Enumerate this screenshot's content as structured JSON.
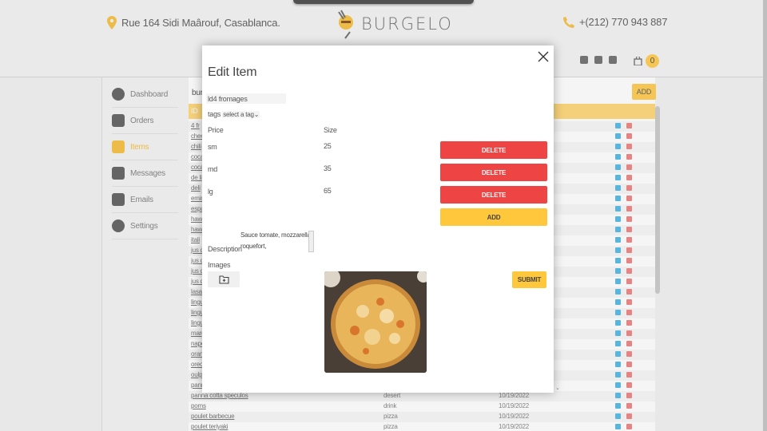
{
  "header": {
    "address": "Rue 164 Sidi Maârouf, Casablanca.",
    "brand": "BURGELO",
    "phone": "+(212) 770 943 887",
    "cart_count": "0"
  },
  "sidebar": {
    "items": [
      {
        "label": "Dashboard",
        "icon": "dashboard-icon"
      },
      {
        "label": "Orders",
        "icon": "orders-icon"
      },
      {
        "label": "Items",
        "icon": "items-icon"
      },
      {
        "label": "Messages",
        "icon": "messages-icon"
      },
      {
        "label": "Emails",
        "icon": "email-icon"
      },
      {
        "label": "Settings",
        "icon": "gear-icon"
      }
    ],
    "active": "Items"
  },
  "table": {
    "title": "bur",
    "add_label": "ADD",
    "header_first": "ID",
    "rows": [
      {
        "name": "4 fr",
        "category": "",
        "date": ""
      },
      {
        "name": "chee",
        "category": "",
        "date": ""
      },
      {
        "name": "chili",
        "category": "",
        "date": ""
      },
      {
        "name": "coca",
        "category": "",
        "date": ""
      },
      {
        "name": "coca",
        "category": "",
        "date": ""
      },
      {
        "name": "de li",
        "category": "",
        "date": ""
      },
      {
        "name": "deli",
        "category": "",
        "date": ""
      },
      {
        "name": "emin",
        "category": "",
        "date": ""
      },
      {
        "name": "espa",
        "category": "",
        "date": ""
      },
      {
        "name": "haw",
        "category": "",
        "date": ""
      },
      {
        "name": "haw",
        "category": "",
        "date": ""
      },
      {
        "name": "itali",
        "category": "",
        "date": ""
      },
      {
        "name": "jus d",
        "category": "",
        "date": ""
      },
      {
        "name": "jus d",
        "category": "",
        "date": ""
      },
      {
        "name": "jus d",
        "category": "",
        "date": ""
      },
      {
        "name": "jus d",
        "category": "",
        "date": ""
      },
      {
        "name": "lasa",
        "category": "",
        "date": ""
      },
      {
        "name": "lingu",
        "category": "",
        "date": ""
      },
      {
        "name": "lingu",
        "category": "",
        "date": ""
      },
      {
        "name": "lingu",
        "category": "",
        "date": ""
      },
      {
        "name": "marg",
        "category": "",
        "date": ""
      },
      {
        "name": "napo",
        "category": "",
        "date": ""
      },
      {
        "name": "oran",
        "category": "",
        "date": ""
      },
      {
        "name": "oreo",
        "category": "",
        "date": ""
      },
      {
        "name": "oulp",
        "category": "",
        "date": ""
      },
      {
        "name": "pann",
        "category": "",
        "date": ""
      },
      {
        "name": "panna cotta speculos",
        "category": "desert",
        "date": "10/19/2022"
      },
      {
        "name": "poms",
        "category": "drink",
        "date": "10/19/2022"
      },
      {
        "name": "poulet barbecue",
        "category": "pizza",
        "date": "10/19/2022"
      },
      {
        "name": "poulet teriyaki",
        "category": "pizza",
        "date": "10/19/2022"
      }
    ]
  },
  "modal": {
    "title": "Edit Item",
    "name_value": "ld4 fromages",
    "tags_label": "tags",
    "tags_select": "select a tag",
    "price_header": "Price",
    "size_header": "Size",
    "prices": [
      {
        "size": "sm",
        "price": "25",
        "delete": "DELETE"
      },
      {
        "size": "md",
        "price": "35",
        "delete": "DELETE"
      },
      {
        "size": "lg",
        "price": "65",
        "delete": "DELETE"
      }
    ],
    "add_label": "ADD",
    "description_label": "Description",
    "description_value": "Sauce tomate, mozzarella, roquefort,",
    "images_label": "Images",
    "submit_label": "SUBMIT"
  },
  "colors": {
    "accent": "#ffc83c",
    "danger": "#ee4444",
    "header_row": "#ffd97f"
  }
}
